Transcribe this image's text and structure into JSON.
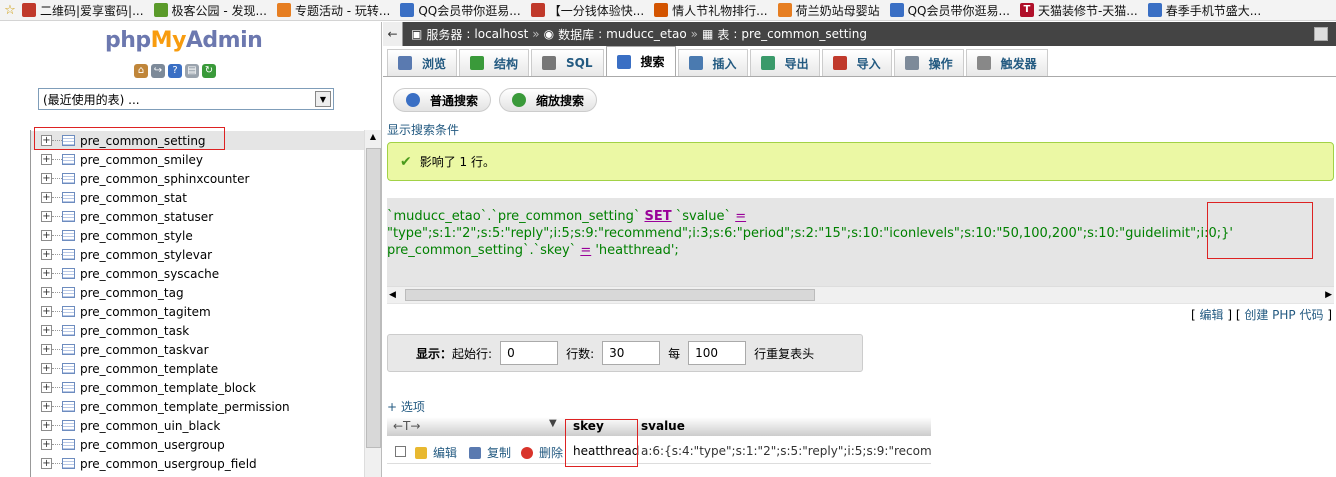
{
  "bookmarks": [
    {
      "label": "二维码|爱享蜜码|...",
      "icon": "qr-icon",
      "color": "#c0392b"
    },
    {
      "label": "极客公园 - 发现...",
      "icon": "flower-icon",
      "color": "#5a9a2a"
    },
    {
      "label": "专题活动 - 玩转...",
      "icon": "badge-icon",
      "color": "#e67e22"
    },
    {
      "label": "QQ会员带你逛易...",
      "icon": "qq-icon",
      "color": "#3a6fc4"
    },
    {
      "label": "【一分钱体验快...",
      "icon": "tmall-icon",
      "color": "#c0392b"
    },
    {
      "label": "情人节礼物排行...",
      "icon": "gift-icon",
      "color": "#d35400"
    },
    {
      "label": "荷兰奶站母婴站",
      "icon": "cart-icon",
      "color": "#e67e22"
    },
    {
      "label": "QQ会员带你逛易...",
      "icon": "qq-icon",
      "color": "#3a6fc4"
    },
    {
      "label": "天猫装修节-天猫...",
      "icon": "t-icon",
      "color": "#b0102a",
      "letter": "T"
    },
    {
      "label": "春季手机节盛大...",
      "icon": "qq-icon",
      "color": "#3a6fc4"
    }
  ],
  "sidebar": {
    "logo": {
      "php": "php",
      "my": "My",
      "admin": "Admin"
    },
    "recent_placeholder": "(最近使用的表) ...",
    "tables": [
      "pre_common_setting",
      "pre_common_smiley",
      "pre_common_sphinxcounter",
      "pre_common_stat",
      "pre_common_statuser",
      "pre_common_style",
      "pre_common_stylevar",
      "pre_common_syscache",
      "pre_common_tag",
      "pre_common_tagitem",
      "pre_common_task",
      "pre_common_taskvar",
      "pre_common_template",
      "pre_common_template_block",
      "pre_common_template_permission",
      "pre_common_uin_black",
      "pre_common_usergroup",
      "pre_common_usergroup_field"
    ]
  },
  "breadcrumb": {
    "server_label": "服务器",
    "server": "localhost",
    "db_label": "数据库",
    "db": "muducc_etao",
    "table_label": "表",
    "table": "pre_common_setting"
  },
  "tabs": [
    {
      "label": "浏览",
      "icon": "browse-icon"
    },
    {
      "label": "结构",
      "icon": "structure-icon"
    },
    {
      "label": "SQL",
      "icon": "sql-icon"
    },
    {
      "label": "搜索",
      "icon": "search-icon",
      "active": true
    },
    {
      "label": "插入",
      "icon": "insert-icon"
    },
    {
      "label": "导出",
      "icon": "export-icon"
    },
    {
      "label": "导入",
      "icon": "import-icon"
    },
    {
      "label": "操作",
      "icon": "wrench-icon"
    },
    {
      "label": "触发器",
      "icon": "trigger-icon"
    }
  ],
  "subtabs": [
    {
      "label": "普通搜索",
      "icon": "search-icon"
    },
    {
      "label": "缩放搜索",
      "icon": "zoom-icon"
    }
  ],
  "show_conditions": "显示搜索条件",
  "success_message": "影响了 1 行。",
  "sql": {
    "line1_a": "`muducc_etao`.`pre_common_setting`",
    "line1_kw": "SET",
    "line1_b": "`svalue`",
    "line1_op": "=",
    "line2": "\"type\";s:1:\"2\";s:5:\"reply\";i:5;s:9:\"recommend\";i:3;s:6:\"period\";s:2:\"15\";s:10:\"iconlevels\";s:10:\"50,100,200\";s:10:\"guidelimit\";i:0;}'",
    "line3_a": "pre_common_setting`.`skey`",
    "line3_op": "=",
    "line3_b": "'heatthread';"
  },
  "edit_links": {
    "edit": "编辑",
    "create_php": "创建 PHP 代码"
  },
  "display": {
    "label": "显示：",
    "start_label": "起始行:",
    "start_value": "0",
    "rows_label": "行数:",
    "rows_value": "30",
    "every_label": "每",
    "every_value": "100",
    "repeat_label": "行重复表头"
  },
  "options_link": "+ 选项",
  "results": {
    "columns": [
      "skey",
      "svalue"
    ],
    "row": {
      "edit": "编辑",
      "copy": "复制",
      "delete": "删除",
      "skey": "heatthread",
      "svalue": "a:6:{s:4:\"type\";s:1:\"2\";s:5:\"reply\";i:5;s:9:\"recom..."
    }
  }
}
